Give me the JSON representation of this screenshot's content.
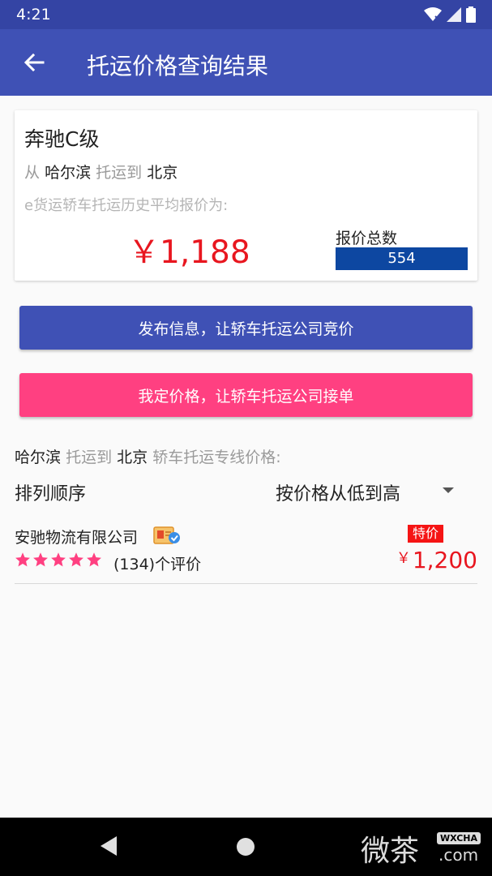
{
  "status_bar": {
    "time": "4:21"
  },
  "app_bar": {
    "title": "托运价格查询结果"
  },
  "summary": {
    "car_model": "奔驰C级",
    "from_word": "从",
    "origin": "哈尔滨",
    "ship_word": "托运到",
    "destination": "北京",
    "history_label": "e货运轿车托运历史平均报价为:",
    "avg_price": "￥1,188",
    "quote_count_label": "报价总数",
    "quote_count": "554",
    "quote_count_fill": 1.0
  },
  "buttons": {
    "publish": "发布信息，让轿车托运公司竞价",
    "fixed_price": "我定价格，让轿车托运公司接单"
  },
  "route_list": {
    "origin": "哈尔滨",
    "ship_word": "托运到",
    "destination": "北京",
    "suffix": "轿车托运专线价格:",
    "sort_label": "排列顺序",
    "sort_value": "按价格从低到高"
  },
  "companies": [
    {
      "name": "安驰物流有限公司",
      "rating": 5,
      "reviews": "(134)个评价",
      "badge": "特价",
      "currency": "￥",
      "price": "1,200"
    }
  ],
  "watermark": {
    "text": "微茶",
    "badge": "WXCHA",
    "domain": ".com"
  },
  "colors": {
    "primary": "#3f51b5",
    "accent": "#ff4081",
    "price_red": "#e8161f",
    "count_bar": "#0d47a1",
    "star": "#ff4081"
  }
}
